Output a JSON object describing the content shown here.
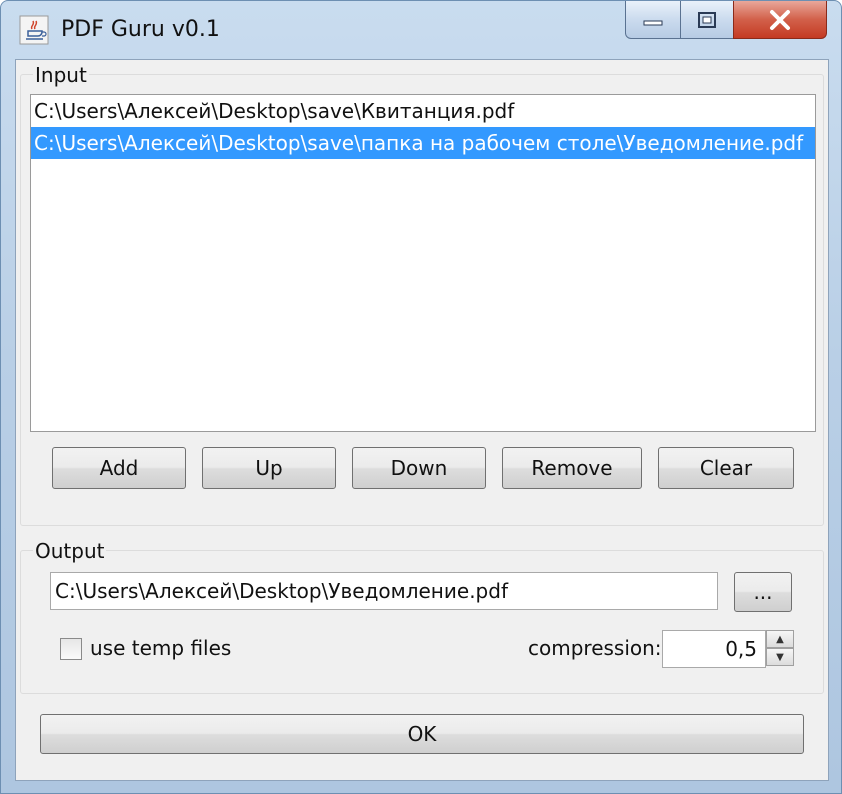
{
  "window": {
    "title": "PDF Guru v0.1"
  },
  "input": {
    "label": "Input",
    "files": [
      "C:\\Users\\Алексей\\Desktop\\save\\Квитанция.pdf",
      "C:\\Users\\Алексей\\Desktop\\save\\папка на рабочем столе\\Уведомление.pdf"
    ],
    "selected_index": 1,
    "buttons": {
      "add": "Add",
      "up": "Up",
      "down": "Down",
      "remove": "Remove",
      "clear": "Clear"
    }
  },
  "output": {
    "label": "Output",
    "path": "C:\\Users\\Алексей\\Desktop\\Уведомление.pdf",
    "browse_label": "...",
    "use_temp_files_label": "use temp files",
    "use_temp_files_checked": false,
    "compression_label": "compression:",
    "compression_value": "0,5"
  },
  "ok_label": "OK",
  "icons": {
    "app": "java-cup-icon",
    "minimize": "minimize-icon",
    "maximize": "maximize-icon",
    "close": "close-icon"
  },
  "colors": {
    "selection": "#3399ff",
    "close_button": "#c43a23"
  }
}
